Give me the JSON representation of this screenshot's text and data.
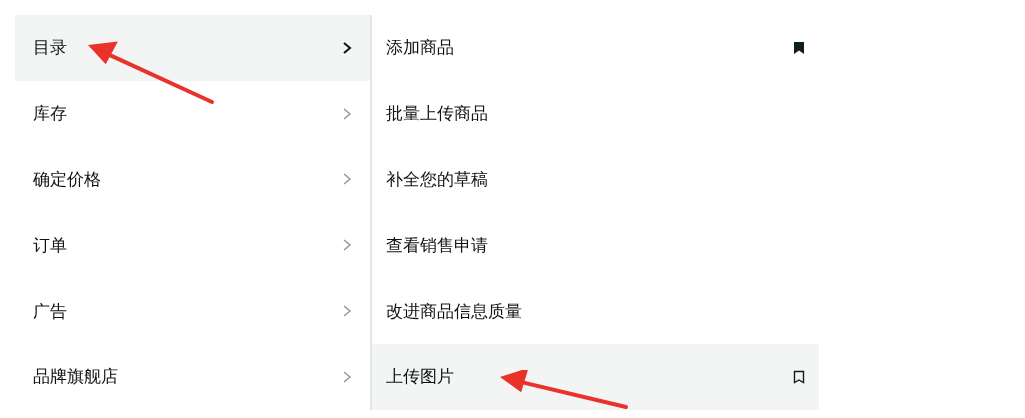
{
  "menu": {
    "items": [
      {
        "label": "目录",
        "selected": true,
        "arrow": true
      },
      {
        "label": "库存",
        "selected": false,
        "arrow": false
      },
      {
        "label": "确定价格",
        "selected": false,
        "arrow": false
      },
      {
        "label": "订单",
        "selected": false,
        "arrow": false
      },
      {
        "label": "广告",
        "selected": false,
        "arrow": false
      },
      {
        "label": "品牌旗舰店",
        "selected": false,
        "arrow": false
      }
    ]
  },
  "submenu": {
    "items": [
      {
        "label": "添加商品",
        "selected": false,
        "bookmarked": true,
        "arrow": false
      },
      {
        "label": "批量上传商品",
        "selected": false,
        "arrow": false
      },
      {
        "label": "补全您的草稿",
        "selected": false,
        "arrow": false
      },
      {
        "label": "查看销售申请",
        "selected": false,
        "arrow": false
      },
      {
        "label": "改进商品信息质量",
        "selected": false,
        "arrow": false
      },
      {
        "label": "上传图片",
        "selected": true,
        "bookmarked": false,
        "arrow": true
      }
    ]
  }
}
